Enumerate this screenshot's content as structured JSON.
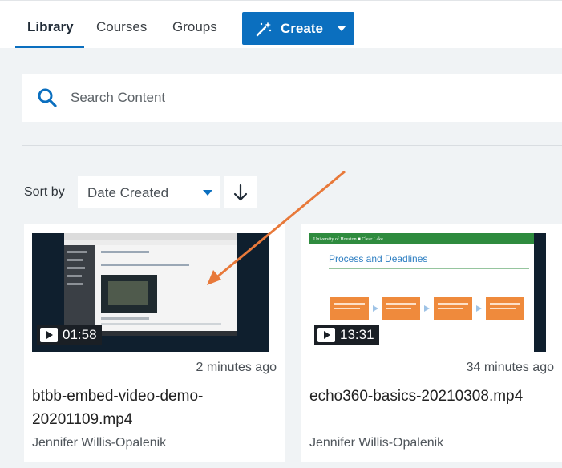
{
  "tabs": [
    {
      "label": "Library",
      "active": true
    },
    {
      "label": "Courses",
      "active": false
    },
    {
      "label": "Groups",
      "active": false
    }
  ],
  "create_button": {
    "label": "Create",
    "icon": "magic-wand-icon"
  },
  "search": {
    "placeholder": "Search Content",
    "icon": "search-icon"
  },
  "sort": {
    "label": "Sort by",
    "selected": "Date Created",
    "direction": "descending"
  },
  "cards": [
    {
      "duration": "01:58",
      "time_ago": "2 minutes ago",
      "title": "btbb-embed-video-demo-20201109.mp4",
      "owner": "Jennifer Willis-Opalenik"
    },
    {
      "duration": "13:31",
      "time_ago": "34 minutes ago",
      "title": "echo360-basics-20210308.mp4",
      "owner": "Jennifer Willis-Opalenik",
      "thumbnail": {
        "header": "University of Houston ■ Clear Lake",
        "slide_title": "Process and Deadlines"
      }
    }
  ],
  "colors": {
    "accent": "#0b6fbf",
    "annotation_arrow": "#e8793a",
    "slide_green": "#2e8b3e",
    "slide_orange": "#ef8a3c"
  }
}
